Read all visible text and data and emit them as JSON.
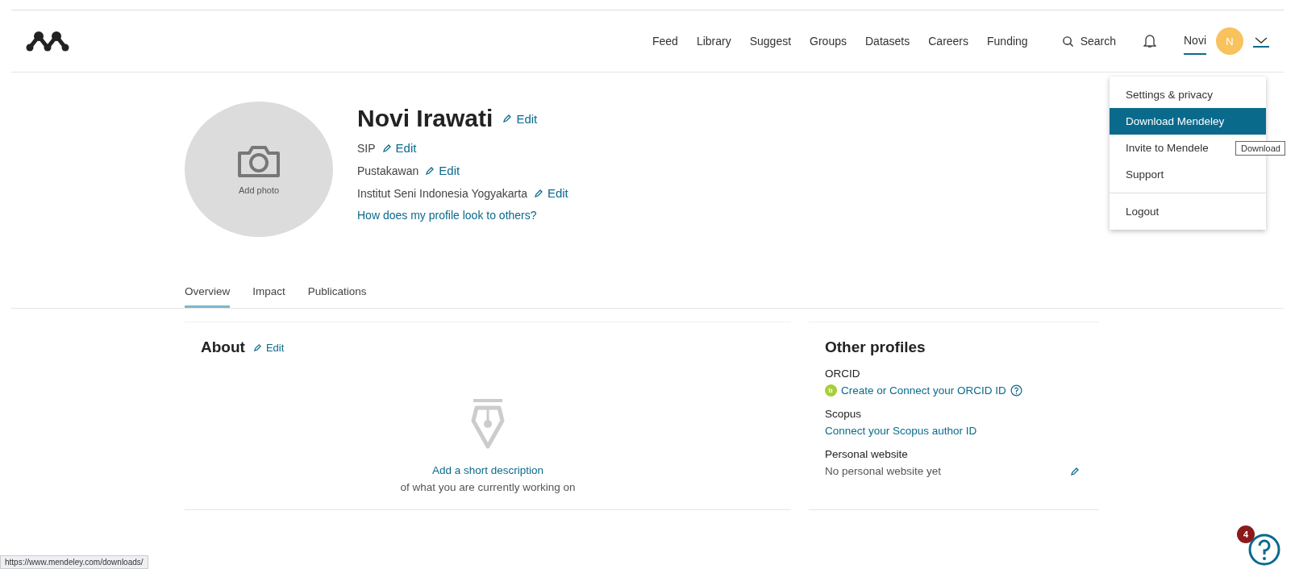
{
  "nav": {
    "links": [
      {
        "label": "Feed"
      },
      {
        "label": "Library"
      },
      {
        "label": "Suggest"
      },
      {
        "label": "Groups"
      },
      {
        "label": "Datasets"
      },
      {
        "label": "Careers"
      },
      {
        "label": "Funding"
      }
    ],
    "search": "Search",
    "user": "Novi",
    "avatar_initial": "N"
  },
  "menu": {
    "items": [
      {
        "label": "Settings & privacy",
        "selected": false
      },
      {
        "label": "Download Mendeley",
        "selected": true
      },
      {
        "label": "Invite to Mendele",
        "selected": false
      },
      {
        "label": "Support",
        "selected": false
      }
    ],
    "footer_items": [
      {
        "label": "Logout",
        "selected": false
      }
    ],
    "tooltip": "Download"
  },
  "profile": {
    "photo_label": "Add photo",
    "name": "Novi Irawati",
    "name_edit": "Edit",
    "fields": [
      {
        "text": "SIP",
        "edit": "Edit"
      },
      {
        "text": "Pustakawan",
        "edit": "Edit"
      },
      {
        "text": "Institut Seni Indonesia Yogyakarta",
        "edit": "Edit"
      }
    ],
    "preview_link": "How does my profile look to others?"
  },
  "tabs": [
    {
      "label": "Overview",
      "selected": true
    },
    {
      "label": "Impact",
      "selected": false
    },
    {
      "label": "Publications",
      "selected": false
    }
  ],
  "about": {
    "title": "About",
    "edit": "Edit",
    "empty_link": "Add a short description",
    "empty_text": "of what you are currently working on"
  },
  "other_profiles": {
    "title": "Other profiles",
    "sections": [
      {
        "label": "ORCID",
        "kind": "orcid",
        "value": "Create or Connect your ORCID ID"
      },
      {
        "label": "Scopus",
        "kind": "link",
        "value": "Connect your Scopus author ID"
      },
      {
        "label": "Personal website",
        "kind": "text",
        "value": "No personal website yet"
      }
    ]
  },
  "help": {
    "badge": "4"
  },
  "status_url": "https://www.mendeley.com/downloads/"
}
